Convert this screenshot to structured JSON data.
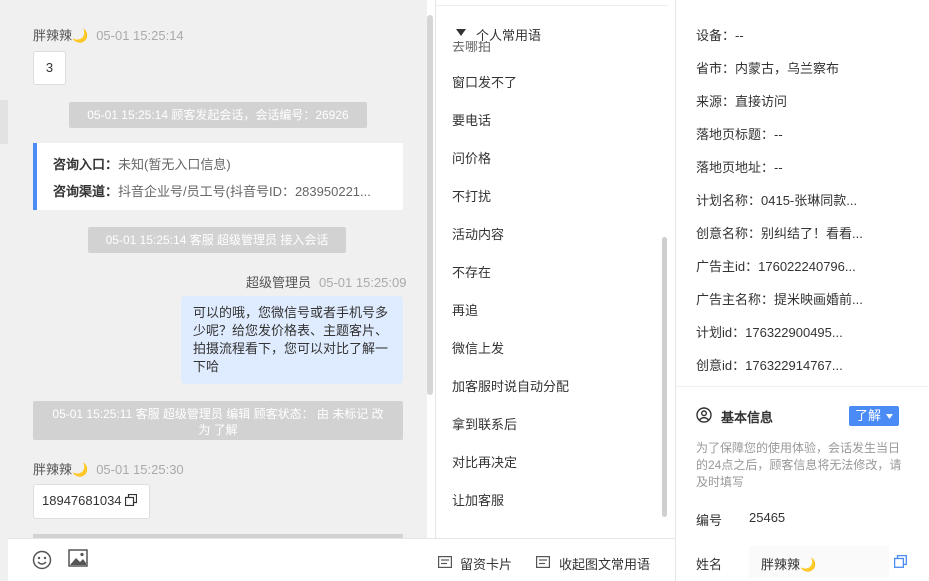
{
  "chat": {
    "msg1": {
      "sender": "胖辣辣🌙",
      "time": "05-01 15:25:14",
      "content": "3"
    },
    "sys1": "05-01 15:25:14 顾客发起会话，会话编号：26926",
    "entry": {
      "label": "咨询入口：",
      "value": "未知(暂无入口信息)"
    },
    "channel": {
      "label": "咨询渠道：",
      "value": "抖音企业号/员工号(抖音号ID：283950221..."
    },
    "sys2": "05-01 15:25:14 客服 超级管理员 接入会话",
    "msg2": {
      "sender": "超级管理员",
      "time": "05-01 15:25:09",
      "lines": [
        "可以的哦，您微信号或者手机号多",
        "少呢？给您发价格表、主题客片、",
        "拍摄流程看下，您可以对比了解一",
        "下哈"
      ]
    },
    "sys3": "05-01 15:25:11 客服 超级管理员 编辑 顾客状态： 由 未标记 改为 了解",
    "msg3": {
      "sender": "胖辣辣🌙",
      "time": "05-01 15:25:30",
      "content": "18947681034"
    }
  },
  "bottom": {
    "card_label": "留资卡片",
    "collect_label": "收起图文常用语"
  },
  "phrases": {
    "header": "个人常用语",
    "partial": "去哪拍",
    "items": [
      "窗口发不了",
      "要电话",
      "问价格",
      "不打扰",
      "活动内容",
      "不存在",
      "再追",
      "微信上发",
      "加客服时说自动分配",
      "拿到联系后",
      "对比再决定",
      "让加客服"
    ]
  },
  "right": {
    "fields": [
      {
        "k": "设备：",
        "v": "--"
      },
      {
        "k": "省市：",
        "v": "内蒙古，乌兰察布"
      },
      {
        "k": "来源：",
        "v": "直接访问"
      },
      {
        "k": "落地页标题：",
        "v": "--"
      },
      {
        "k": "落地页地址：",
        "v": "--"
      },
      {
        "k": "计划名称：",
        "v": "0415-张琳同款..."
      },
      {
        "k": "创意名称：",
        "v": "别纠结了！看看..."
      },
      {
        "k": "广告主id：",
        "v": "176022240796..."
      },
      {
        "k": "广告主名称：",
        "v": "提米映画婚前..."
      },
      {
        "k": "计划id：",
        "v": "176322900495..."
      },
      {
        "k": "创意id：",
        "v": "176322914767..."
      }
    ],
    "basic_title": "基本信息",
    "status_button": "了解",
    "notice": "为了保障您的使用体验，会话发生当日的24点之后，顾客信息将无法修改，请及时填写",
    "id_label": "编号",
    "id_value": "25465",
    "name_label": "姓名",
    "name_value": "胖辣辣🌙"
  },
  "colors": {
    "accent": "#4a8bf5",
    "bubble_out": "#dfebfe",
    "system": "#d2d2d2"
  }
}
